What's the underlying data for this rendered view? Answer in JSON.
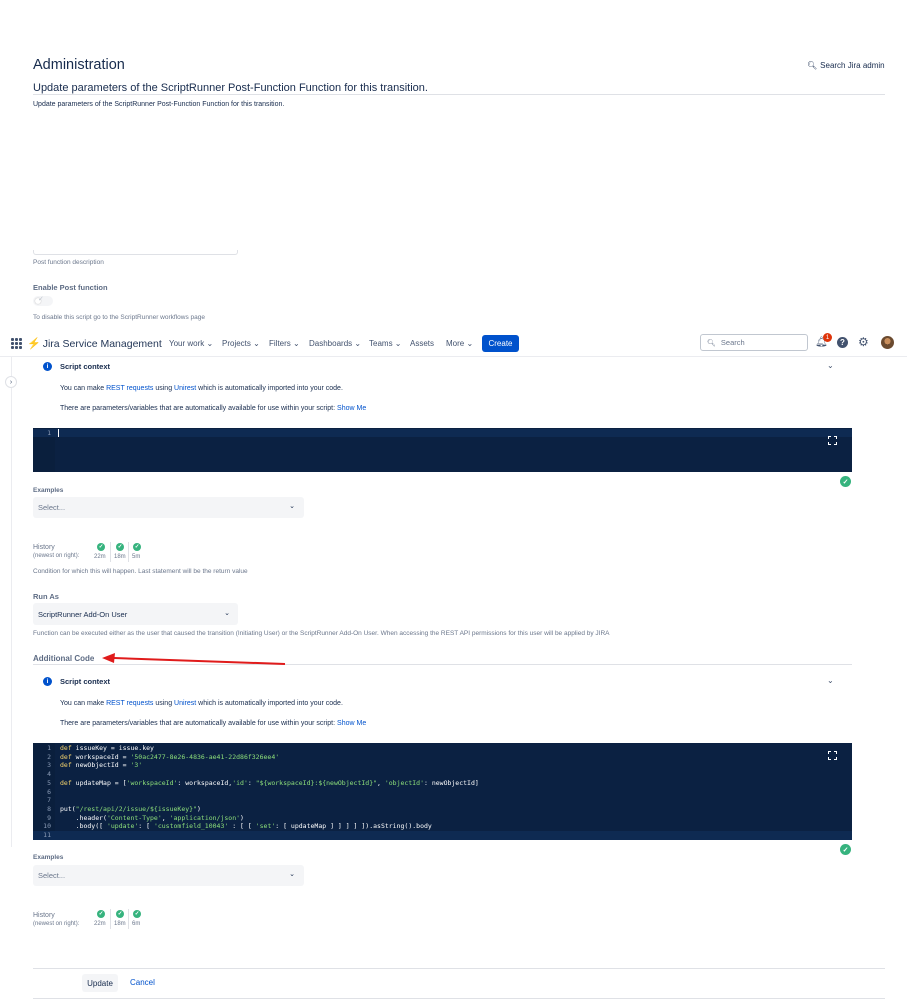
{
  "header": {
    "title": "Administration",
    "search_admin": "Search Jira admin",
    "heading": "Update parameters of the ScriptRunner Post-Function Function for this transition.",
    "subheading": "Update parameters of the ScriptRunner Post-Function Function for this transition."
  },
  "post_function": {
    "description_hint": "Post function description",
    "enable_label": "Enable Post function",
    "disable_hint": "To disable this script go to the ScriptRunner workflows page"
  },
  "nav": {
    "product": "Jira Service Management",
    "items": [
      "Your work",
      "Projects",
      "Filters",
      "Dashboards",
      "Teams",
      "Assets",
      "More"
    ],
    "create": "Create",
    "search_placeholder": "Search",
    "notification_count": "1",
    "help": "?"
  },
  "condition_section": {
    "context_title": "Script context",
    "line1_prefix": "You can make ",
    "line1_link1": "REST requests",
    "line1_mid": " using ",
    "line1_link2": "Unirest",
    "line1_suffix": " which is automatically imported into your code.",
    "line2_prefix": "There are parameters/variables that are automatically available for use within your script: ",
    "line2_link": "Show Me",
    "code_lines": [
      "1"
    ],
    "examples_label": "Examples",
    "examples_placeholder": "Select...",
    "history_label": "History",
    "history_sub": "(newest on right):",
    "history_times": [
      "22m",
      "18m",
      "5m"
    ],
    "hint": "Condition for which this will happen. Last statement will be the return value"
  },
  "run_as": {
    "label": "Run As",
    "value": "ScriptRunner Add-On User",
    "hint": "Function can be executed either as the user that caused the transition (Initiating User) or the ScriptRunner Add-On User. When accessing the REST API permissions for this user will be applied by JIRA"
  },
  "additional_code": {
    "label": "Additional Code",
    "context_title": "Script context",
    "line1_prefix": "You can make ",
    "line1_link1": "REST requests",
    "line1_mid": " using ",
    "line1_link2": "Unirest",
    "line1_suffix": " which is automatically imported into your code.",
    "line2_prefix": "There are parameters/variables that are automatically available for use within your script: ",
    "line2_link": "Show Me",
    "examples_label": "Examples",
    "examples_placeholder": "Select...",
    "history_label": "History",
    "history_sub": "(newest on right):",
    "history_times": [
      "22m",
      "18m",
      "6m"
    ],
    "code": [
      {
        "n": "1",
        "parts": [
          [
            "kw",
            "def"
          ],
          [
            "t",
            " issueKey = issue.key"
          ]
        ]
      },
      {
        "n": "2",
        "parts": [
          [
            "kw",
            "def"
          ],
          [
            "t",
            " workspaceId = "
          ],
          [
            "str",
            "'50ac2477-8e26-4836-ae41-22d86f326ee4'"
          ]
        ]
      },
      {
        "n": "3",
        "parts": [
          [
            "kw",
            "def"
          ],
          [
            "t",
            " newObjectId = "
          ],
          [
            "str",
            "'3'"
          ]
        ]
      },
      {
        "n": "4",
        "parts": []
      },
      {
        "n": "5",
        "parts": [
          [
            "kw",
            "def"
          ],
          [
            "t",
            " updateMap = ["
          ],
          [
            "str",
            "'workspaceId'"
          ],
          [
            "t",
            ": workspaceId,"
          ],
          [
            "str",
            "'id'"
          ],
          [
            "t",
            ": "
          ],
          [
            "str",
            "\"${workspaceId}:${newObjectId}\""
          ],
          [
            "t",
            ", "
          ],
          [
            "str",
            "'objectId'"
          ],
          [
            "t",
            ": newObjectId]"
          ]
        ]
      },
      {
        "n": "6",
        "parts": []
      },
      {
        "n": "7",
        "parts": []
      },
      {
        "n": "8",
        "parts": [
          [
            "t",
            "put("
          ],
          [
            "str",
            "\"/rest/api/2/issue/${issueKey}\""
          ],
          [
            "t",
            ")"
          ]
        ]
      },
      {
        "n": "9",
        "parts": [
          [
            "t",
            "    .header("
          ],
          [
            "str",
            "'Content-Type'"
          ],
          [
            "t",
            ", "
          ],
          [
            "str",
            "'application/json'"
          ],
          [
            "t",
            ")"
          ]
        ]
      },
      {
        "n": "10",
        "parts": [
          [
            "t",
            "    .body([ "
          ],
          [
            "str",
            "'update'"
          ],
          [
            "t",
            ": [ "
          ],
          [
            "str",
            "'customfield_10043'"
          ],
          [
            "t",
            " : [ [ "
          ],
          [
            "str",
            "'set'"
          ],
          [
            "t",
            ": [ updateMap ] ] ] ] ]).asString().body"
          ]
        ]
      },
      {
        "n": "11",
        "parts": []
      }
    ]
  },
  "footer": {
    "update": "Update",
    "cancel": "Cancel"
  },
  "colors": {
    "primary": "#0052cc",
    "code_bg": "#0b2142",
    "success": "#36b37e",
    "annotation_arrow": "#e01b1b"
  },
  "icons": [
    "search-icon",
    "grid-icon",
    "bolt-logo-icon",
    "bell-icon",
    "help-icon",
    "gear-icon",
    "info-icon",
    "chevron-down-icon",
    "expand-icon",
    "check-circle-icon",
    "red-arrow-annotation"
  ]
}
